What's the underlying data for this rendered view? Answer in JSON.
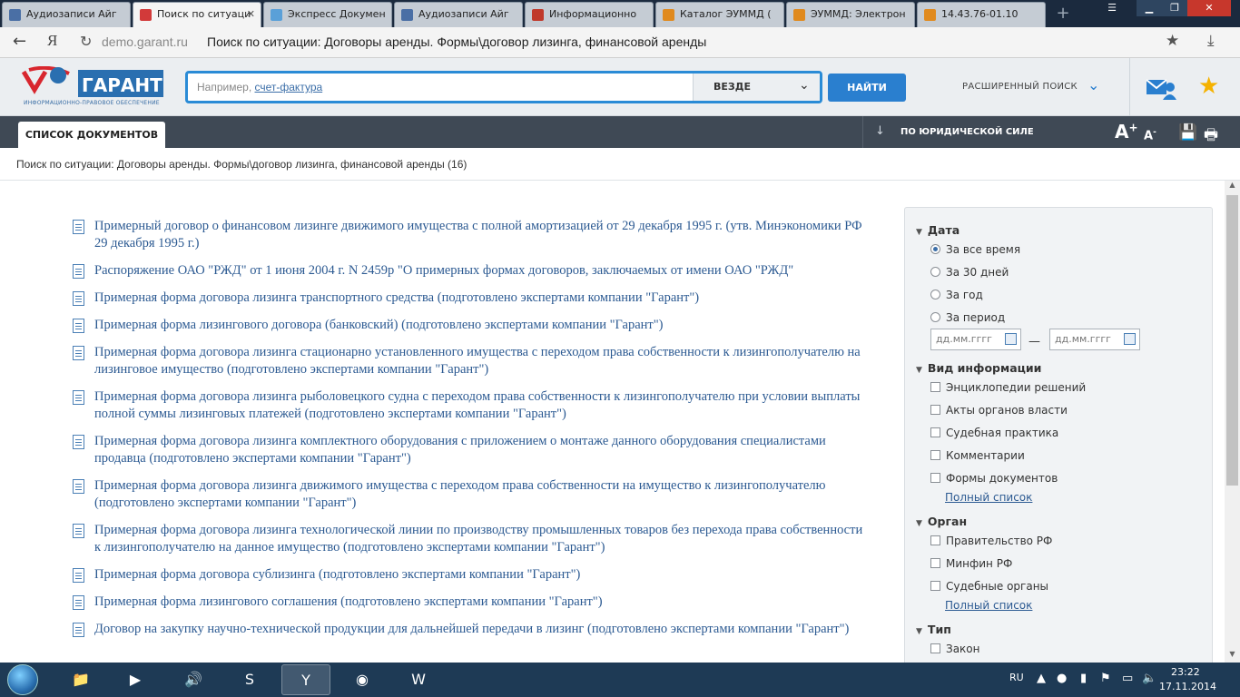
{
  "browser": {
    "tabs": [
      {
        "label": "Аудиозаписи Айг",
        "fav_color": "#4a6fa5"
      },
      {
        "label": "Поиск по ситуаци",
        "fav_color": "#d23a3a"
      },
      {
        "label": "Экспресс Докумен",
        "fav_color": "#5aa0d8"
      },
      {
        "label": "Аудиозаписи Айг",
        "fav_color": "#4a6fa5"
      },
      {
        "label": "Информационно",
        "fav_color": "#c0392b"
      },
      {
        "label": "Каталог ЭУММД (",
        "fav_color": "#e08a1e"
      },
      {
        "label": "ЭУММД: Электрон",
        "fav_color": "#e08a1e"
      },
      {
        "label": "14.43.76-01.10",
        "fav_color": "#e08a1e"
      }
    ],
    "active_tab": 1,
    "url_domain": "demo.garant.ru",
    "url_title": "Поиск по ситуации: Договоры аренды. Формы\\договор лизинга, финансовой аренды"
  },
  "garant": {
    "logo_text": "ГАРАНТ",
    "logo_subtitle": "ИНФОРМАЦИОННО-ПРАВОВОЕ ОБЕСПЕЧЕНИЕ",
    "search_placeholder_prefix": "Например,",
    "search_placeholder_link": "счет-фактура",
    "scope_label": "ВЕЗДЕ",
    "find_label": "НАЙТИ",
    "advanced_label": "РАСШИРЕННЫЙ ПОИСК"
  },
  "toolbar": {
    "doclist_tab": "СПИСОК ДОКУМЕНТОВ",
    "sort_label": "ПО ЮРИДИЧЕСКОЙ СИЛЕ",
    "font_up": "A",
    "font_down": "A"
  },
  "breadcrumb": "Поиск по ситуации: Договоры аренды. Формы\\договор лизинга, финансовой аренды (16)",
  "documents": [
    "Примерный договор о финансовом лизинге движимого имущества с полной амортизацией от 29 декабря 1995 г. (утв. Минэкономики РФ 29 декабря 1995 г.)",
    "Распоряжение ОАО \"РЖД\" от 1 июня 2004 г. N 2459р \"О примерных формах договоров, заключаемых от имени ОАО \"РЖД\"",
    "Примерная форма договора лизинга транспортного средства (подготовлено экспертами компании \"Гарант\")",
    "Примерная форма лизингового договора (банковский) (подготовлено экспертами компании \"Гарант\")",
    "Примерная форма договора лизинга стационарно установленного имущества с переходом права собственности к лизингополучателю на лизинговое имущество (подготовлено экспертами компании \"Гарант\")",
    "Примерная форма договора лизинга рыболовецкого судна с переходом права собственности к лизингополучателю при условии выплаты полной суммы лизинговых платежей (подготовлено экспертами компании \"Гарант\")",
    "Примерная форма договора лизинга комплектного оборудования с приложением о монтаже данного оборудования специалистами продавца (подготовлено экспертами компании \"Гарант\")",
    "Примерная форма договора лизинга движимого имущества с переходом права собственности на имущество к лизингополучателю (подготовлено экспертами компании \"Гарант\")",
    "Примерная форма договора лизинга технологической линии по производству промышленных товаров без перехода права собственности к лизингополучателю на данное имущество (подготовлено экспертами компании \"Гарант\")",
    "Примерная форма договора сублизинга (подготовлено экспертами компании \"Гарант\")",
    "Примерная форма лизингового соглашения (подготовлено экспертами компании \"Гарант\")",
    "Договор на закупку научно-технической продукции для дальнейшей передачи в лизинг (подготовлено экспертами компании \"Гарант\")"
  ],
  "filters": {
    "date": {
      "title": "Дата",
      "options": [
        "За все время",
        "За 30 дней",
        "За год",
        "За период"
      ],
      "selected": 0,
      "from_placeholder": "дд.мм.гггг",
      "to_placeholder": "дд.мм.гггг"
    },
    "info_type": {
      "title": "Вид информации",
      "options": [
        "Энциклопедии решений",
        "Акты органов власти",
        "Судебная практика",
        "Комментарии",
        "Формы документов"
      ],
      "full_list": "Полный список"
    },
    "organ": {
      "title": "Орган",
      "options": [
        "Правительство РФ",
        "Минфин РФ",
        "Судебные органы"
      ],
      "full_list": "Полный список"
    },
    "type": {
      "title": "Тип",
      "options": [
        "Закон"
      ]
    }
  },
  "taskbar": {
    "lang": "RU",
    "time": "23:22",
    "date": "17.11.2014"
  }
}
